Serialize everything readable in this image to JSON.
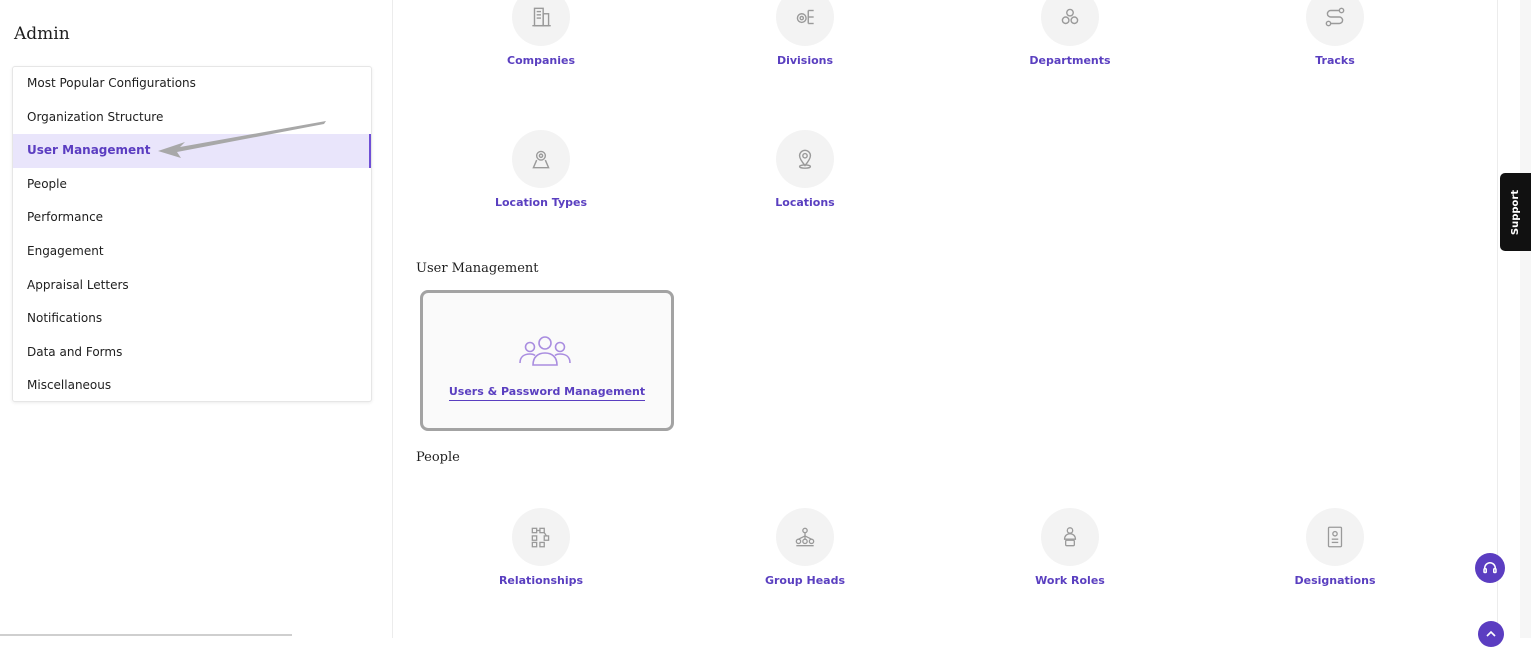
{
  "sidebar": {
    "title": "Admin",
    "items": [
      {
        "label": "Most Popular Configurations"
      },
      {
        "label": "Organization Structure"
      },
      {
        "label": "User Management",
        "active": true
      },
      {
        "label": "People"
      },
      {
        "label": "Performance"
      },
      {
        "label": "Engagement"
      },
      {
        "label": "Appraisal Letters"
      },
      {
        "label": "Notifications"
      },
      {
        "label": "Data and Forms"
      },
      {
        "label": "Miscellaneous"
      }
    ]
  },
  "org_structure": {
    "tiles": [
      {
        "label": "Companies",
        "icon": "building-icon"
      },
      {
        "label": "Divisions",
        "icon": "divisions-icon"
      },
      {
        "label": "Departments",
        "icon": "departments-icon"
      },
      {
        "label": "Tracks",
        "icon": "tracks-icon"
      },
      {
        "label": "Location Types",
        "icon": "location-type-icon"
      },
      {
        "label": "Locations",
        "icon": "location-pin-icon"
      }
    ]
  },
  "user_management": {
    "heading": "User Management",
    "tile": {
      "label": "Users & Password Management",
      "icon": "users-group-icon"
    }
  },
  "people": {
    "heading": "People",
    "tiles": [
      {
        "label": "Relationships",
        "icon": "relationships-icon"
      },
      {
        "label": "Group Heads",
        "icon": "group-heads-icon"
      },
      {
        "label": "Work Roles",
        "icon": "work-roles-icon"
      },
      {
        "label": "Designations",
        "icon": "designations-icon"
      }
    ]
  },
  "support": {
    "label": "Support"
  },
  "colors": {
    "accent": "#5b3dc1",
    "active_bg": "#e9e5fb",
    "icon_gray": "#9a9a9a"
  }
}
